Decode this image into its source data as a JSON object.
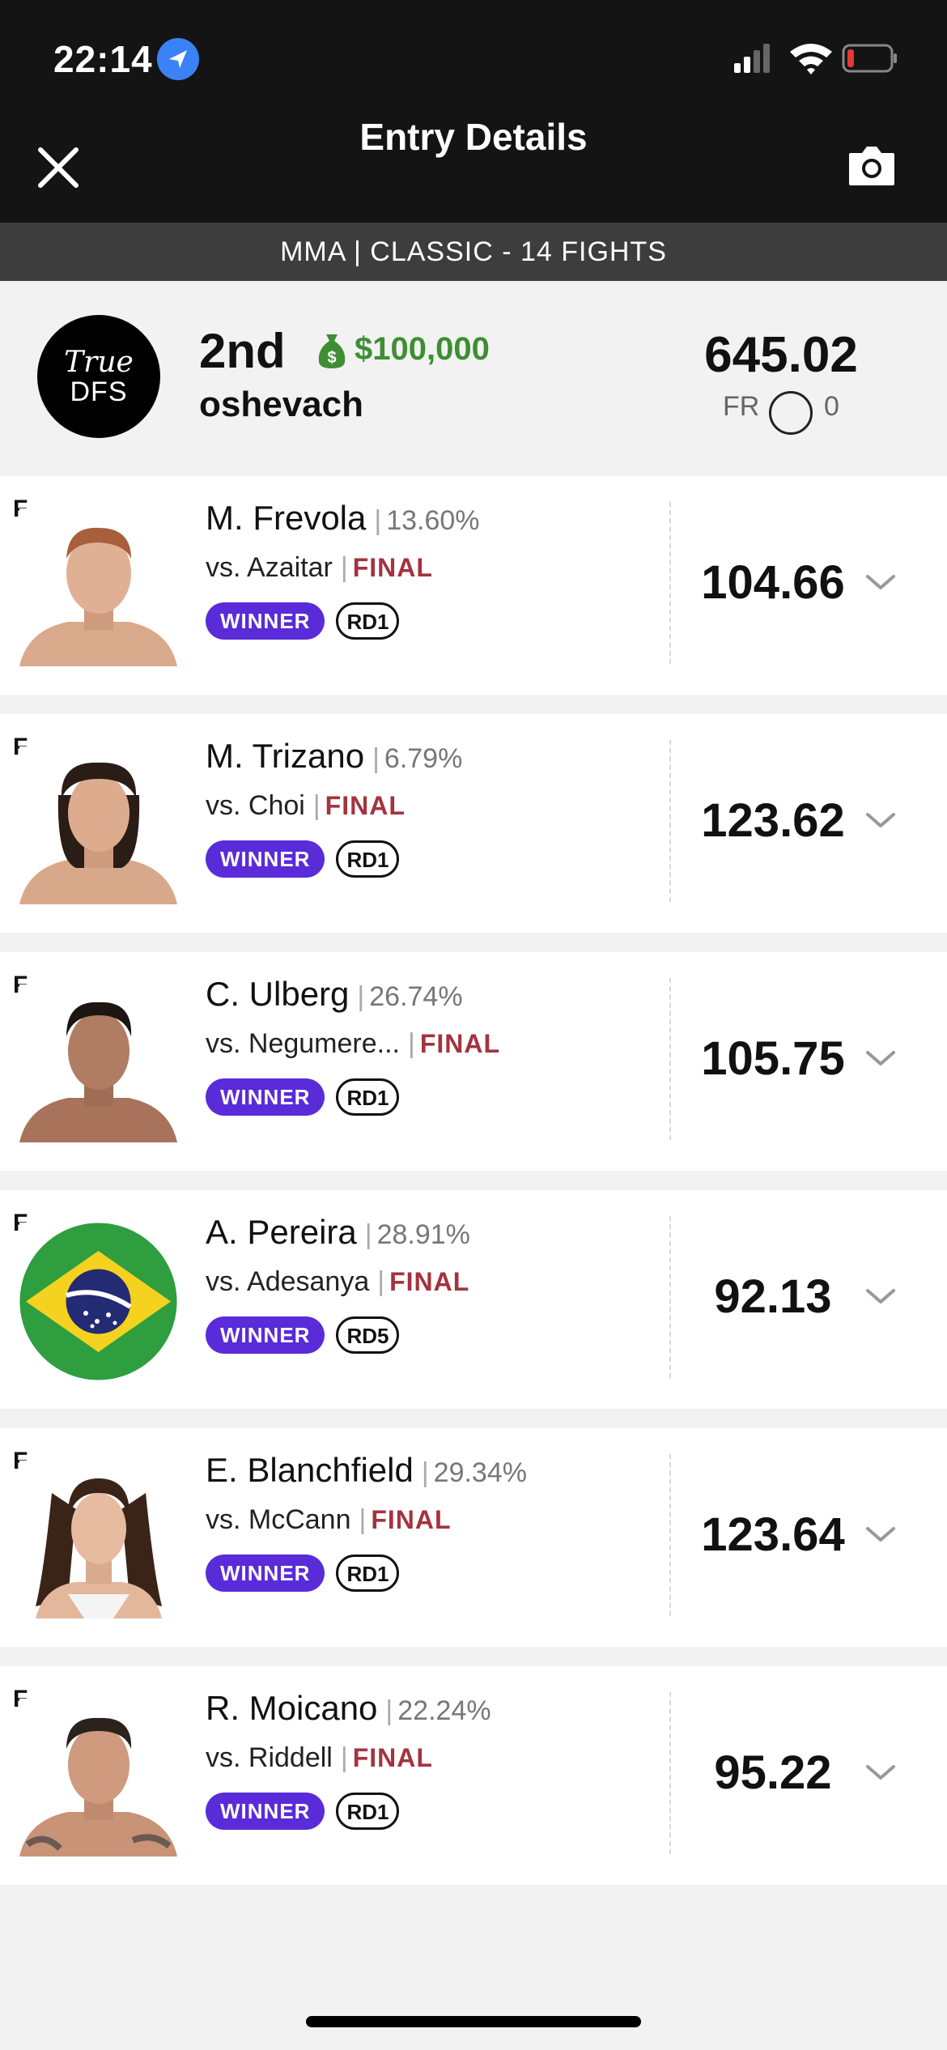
{
  "status_bar": {
    "time": "22:14"
  },
  "header": {
    "title": "Entry Details"
  },
  "contest": {
    "label": "MMA | CLASSIC - 14 FIGHTS"
  },
  "summary": {
    "logo_line1": "True",
    "logo_line2": "DFS",
    "rank": "2nd",
    "prize": "$100,000",
    "username": "oshevach",
    "total_points": "645.02",
    "fr_label": "FR",
    "fr_count": "0"
  },
  "colors": {
    "accent_purple": "#5a2bd9",
    "final_red": "#a4333e",
    "prize_green": "#3e8e34"
  },
  "lineup": [
    {
      "pos": "F",
      "name": "M. Frevola",
      "sep": "|",
      "ownership": "13.60%",
      "opponent": "vs. Azaitar",
      "status": "FINAL",
      "result": "WINNER",
      "round": "RD1",
      "points": "104.66"
    },
    {
      "pos": "F",
      "name": "M. Trizano",
      "sep": "|",
      "ownership": "6.79%",
      "opponent": "vs. Choi",
      "status": "FINAL",
      "result": "WINNER",
      "round": "RD1",
      "points": "123.62"
    },
    {
      "pos": "F",
      "name": "C. Ulberg",
      "sep": "|",
      "ownership": "26.74%",
      "opponent": "vs. Negumere...",
      "status": "FINAL",
      "result": "WINNER",
      "round": "RD1",
      "points": "105.75"
    },
    {
      "pos": "F",
      "name": "A. Pereira",
      "sep": "|",
      "ownership": "28.91%",
      "opponent": "vs. Adesanya",
      "status": "FINAL",
      "result": "WINNER",
      "round": "RD5",
      "points": "92.13"
    },
    {
      "pos": "F",
      "name": "E. Blanchfield",
      "sep": "|",
      "ownership": "29.34%",
      "opponent": "vs. McCann",
      "status": "FINAL",
      "result": "WINNER",
      "round": "RD1",
      "points": "123.64"
    },
    {
      "pos": "F",
      "name": "R. Moicano",
      "sep": "|",
      "ownership": "22.24%",
      "opponent": "vs. Riddell",
      "status": "FINAL",
      "result": "WINNER",
      "round": "RD1",
      "points": "95.22"
    }
  ]
}
